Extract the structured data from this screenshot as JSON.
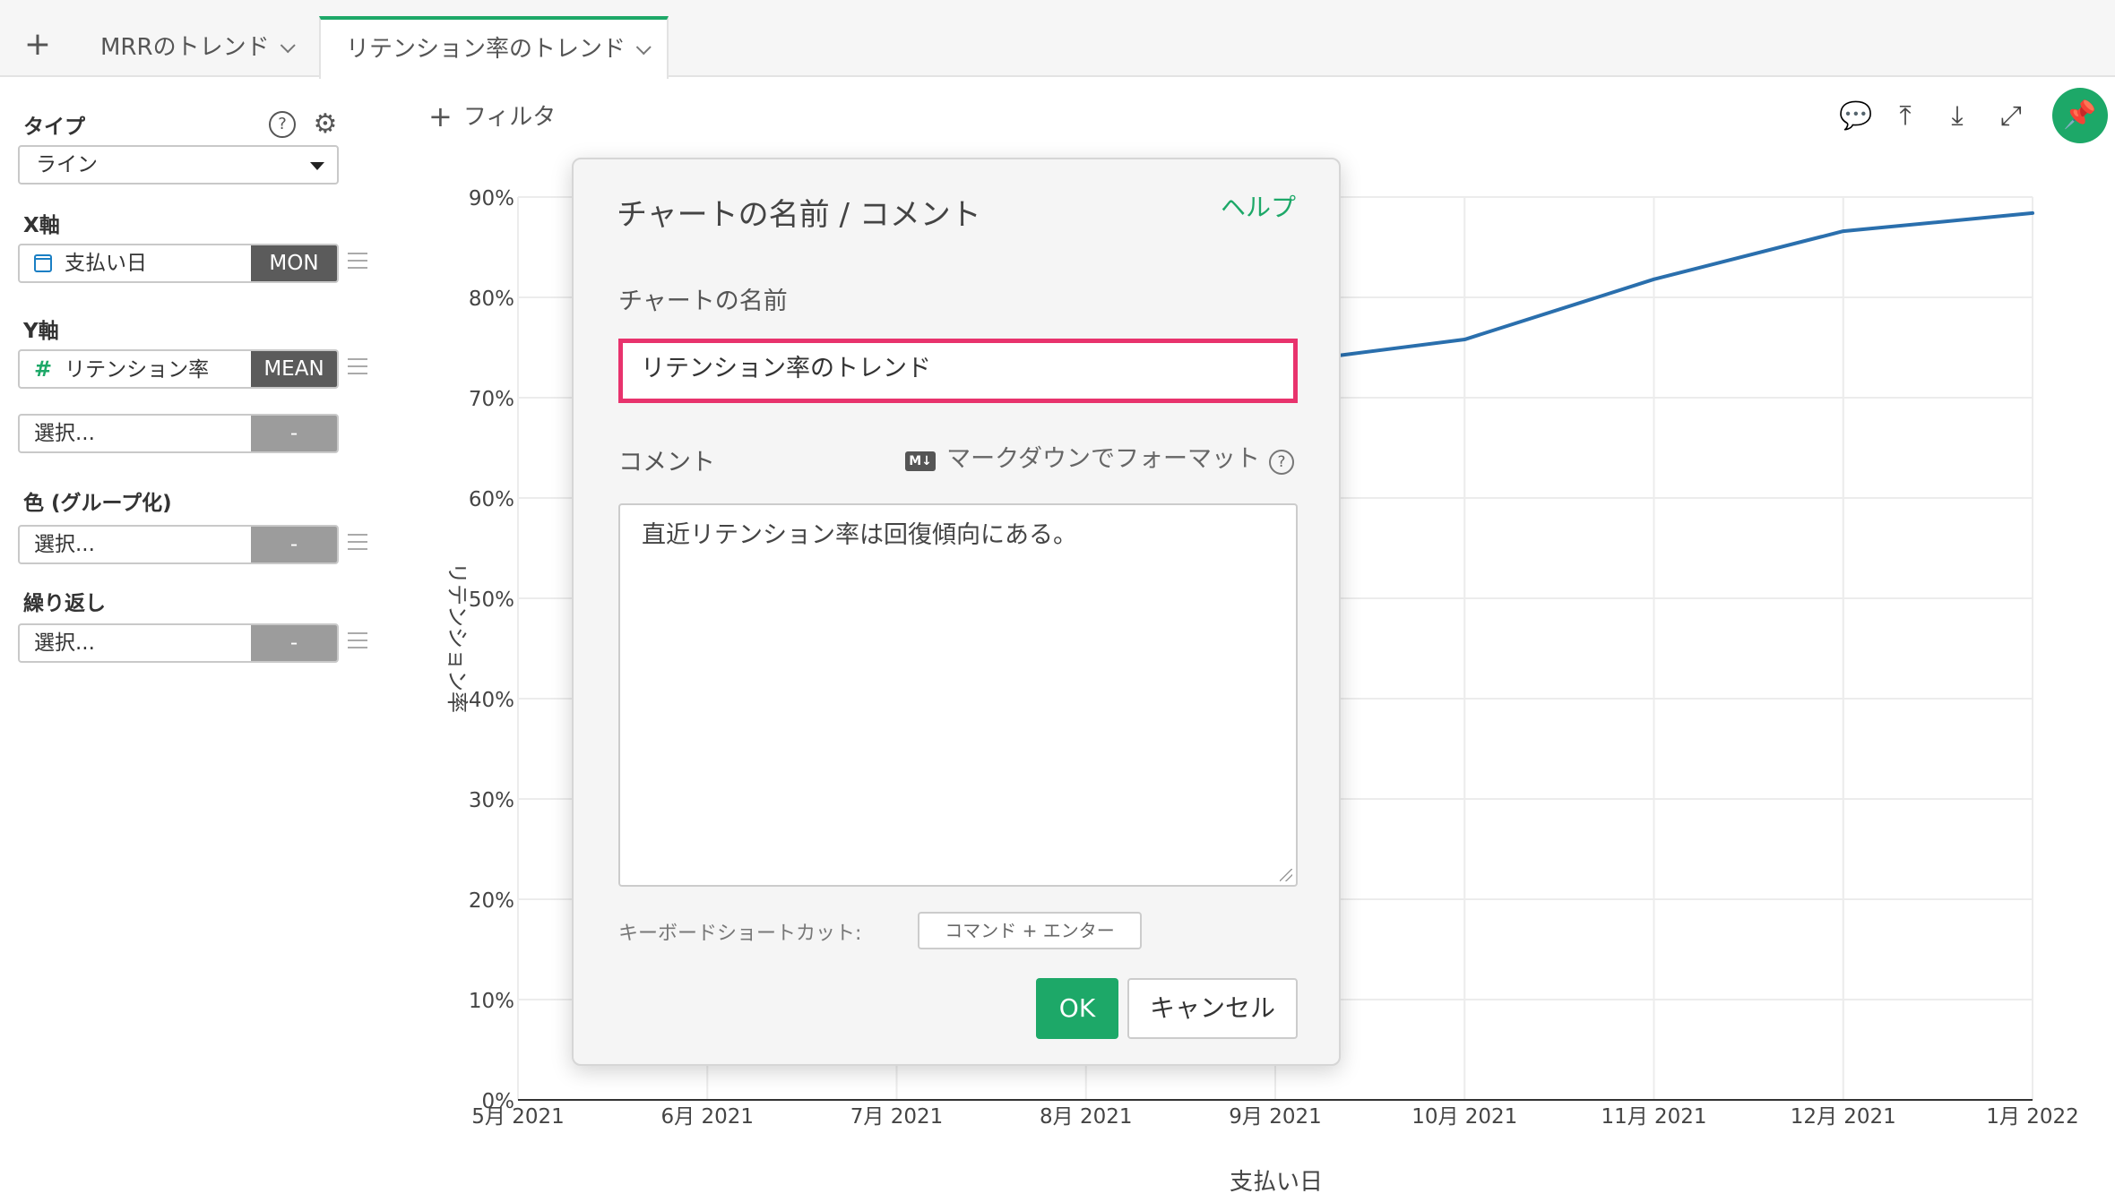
{
  "tabs": {
    "add_label": "+",
    "items": [
      {
        "label": "MRRのトレンド"
      },
      {
        "label": "リテンション率のトレンド"
      }
    ]
  },
  "panel": {
    "type_label": "タイプ",
    "type_value": "ライン",
    "x_label": "X軸",
    "x_field": "支払い日",
    "x_agg": "MON",
    "y_label": "Y軸",
    "y_field": "リテンション率",
    "y_agg": "MEAN",
    "y2_placeholder": "選択...",
    "y2_agg": "-",
    "color_label": "色 (グループ化)",
    "color_placeholder": "選択...",
    "color_agg": "-",
    "repeat_label": "繰り返し",
    "repeat_placeholder": "選択...",
    "repeat_agg": "-"
  },
  "toolbar": {
    "filter_plus": "+",
    "filter_label": "フィルタ"
  },
  "icons": {
    "help": "question-icon",
    "settings": "gear-icon",
    "comment": "chat-icon",
    "upload": "upload-icon",
    "download": "download-icon",
    "expand": "expand-icon",
    "pin": "pin-icon"
  },
  "colors": {
    "accent": "#1da868",
    "line": "#2a6fad",
    "highlight": "#e8336d"
  },
  "dialog": {
    "title": "チャートの名前 / コメント",
    "help": "ヘルプ",
    "name_label": "チャートの名前",
    "name_value": "リテンション率のトレンド",
    "comment_label": "コメント",
    "markdown_label": "マークダウンでフォーマット",
    "md_badge": "M↓",
    "comment_value": "直近リテンション率は回復傾向にある。",
    "shortcut_label": "キーボードショートカット:",
    "shortcut_key": "コマンド + エンター",
    "ok": "OK",
    "cancel": "キャンセル"
  },
  "chart_data": {
    "type": "line",
    "x": [
      "5月 2021",
      "6月 2021",
      "7月 2021",
      "8月 2021",
      "9月 2021",
      "10月 2021",
      "11月 2021",
      "12月 2021",
      "1月 2022"
    ],
    "series": [
      {
        "values": [
          null,
          null,
          null,
          null,
          null,
          75.8,
          81.8,
          86.6,
          88.4
        ]
      }
    ],
    "ylim": [
      0,
      90
    ],
    "yticks": [
      "0%",
      "10%",
      "20%",
      "30%",
      "40%",
      "50%",
      "60%",
      "70%",
      "80%",
      "90%"
    ],
    "xlabel": "支払い日",
    "ylabel": "リテンション率",
    "grid": true
  }
}
